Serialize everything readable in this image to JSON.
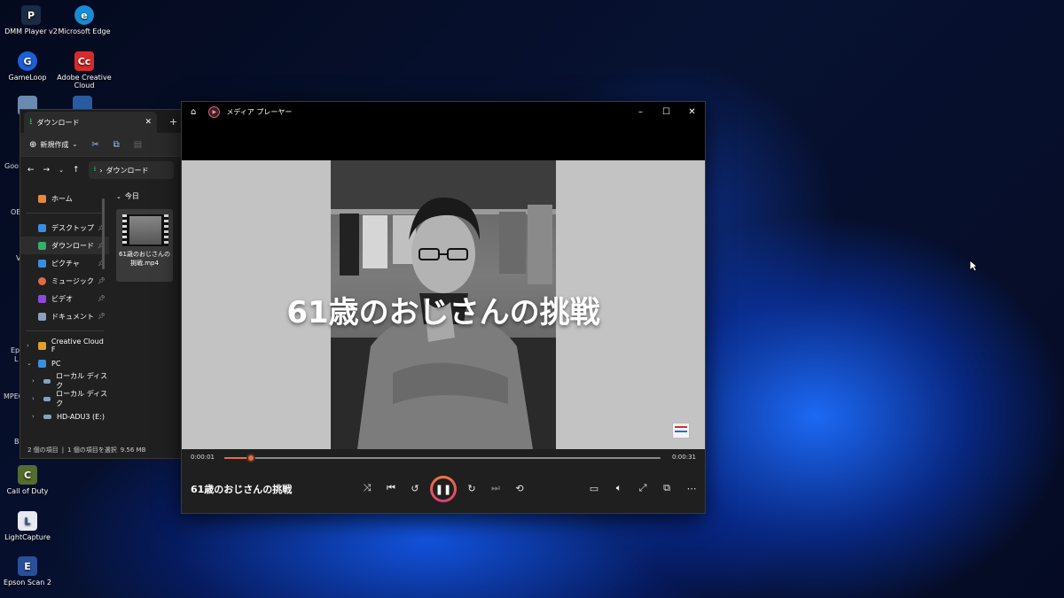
{
  "desktop": {
    "icons": [
      {
        "label": "DMM Player v2",
        "glyph": "P",
        "color": "#1d2a44"
      },
      {
        "label": "Microsoft Edge",
        "glyph": "e",
        "color": "#1a8ad4"
      },
      {
        "label": "GameLoop",
        "glyph": "G",
        "color": "#1d5fd6"
      },
      {
        "label": "Adobe Creative Cloud",
        "glyph": "Cc",
        "color": "#d82a2a"
      },
      {
        "label": "Call of Duty",
        "glyph": "C",
        "color": "#556b2f"
      },
      {
        "label": "LightCapture",
        "glyph": "L",
        "color": "#2a4a8a"
      },
      {
        "label": "Epson Scan 2",
        "glyph": "E",
        "color": "#2a4f9a"
      }
    ],
    "fragments": [
      "Goo",
      "OB",
      "V",
      "Ep",
      "L",
      "MPEG",
      "Ba"
    ]
  },
  "explorer": {
    "tab_title": "ダウンロード",
    "close_glyph": "✕",
    "newtab_glyph": "+",
    "new_label": "新規作成",
    "address": "ダウンロード",
    "nav_items": [
      {
        "label": "ホーム",
        "color": "#e58a3a"
      },
      {
        "label": "デスクトップ",
        "color": "#3a8ee0"
      },
      {
        "label": "ダウンロード",
        "color": "#35b06a"
      },
      {
        "label": "ピクチャ",
        "color": "#3a8ee0"
      },
      {
        "label": "ミュージック",
        "color": "#e06a4a"
      },
      {
        "label": "ビデオ",
        "color": "#8a4ae0"
      },
      {
        "label": "ドキュメント",
        "color": "#8aa0c0"
      }
    ],
    "tree_items": [
      {
        "label": "Creative Cloud F",
        "chev": "›",
        "color": "#e0a030"
      },
      {
        "label": "PC",
        "chev": "⌄",
        "color": "#3a8ee0"
      },
      {
        "label": "ローカル ディスク",
        "chev": "›",
        "color": "#8aa0c0"
      },
      {
        "label": "ローカル ディスク",
        "chev": "›",
        "color": "#8aa0c0"
      },
      {
        "label": "HD-ADU3 (E:)",
        "chev": "›",
        "color": "#8aa0c0"
      }
    ],
    "group_label": "今日",
    "file_name": "61歳のおじさんの挑戦.mp4",
    "status": {
      "items": "2 個の項目",
      "selected": "1 個の項目を選択",
      "size": "9.56 MB"
    }
  },
  "player": {
    "app_title": "メディア プレーヤー",
    "overlay_title": "61歳のおじさんの挑戦",
    "track_name": "61歳のおじさんの挑戦",
    "time_current": "0:00:01",
    "time_total": "0:00:31",
    "progress": 0.06,
    "accent": "#e2704a"
  }
}
